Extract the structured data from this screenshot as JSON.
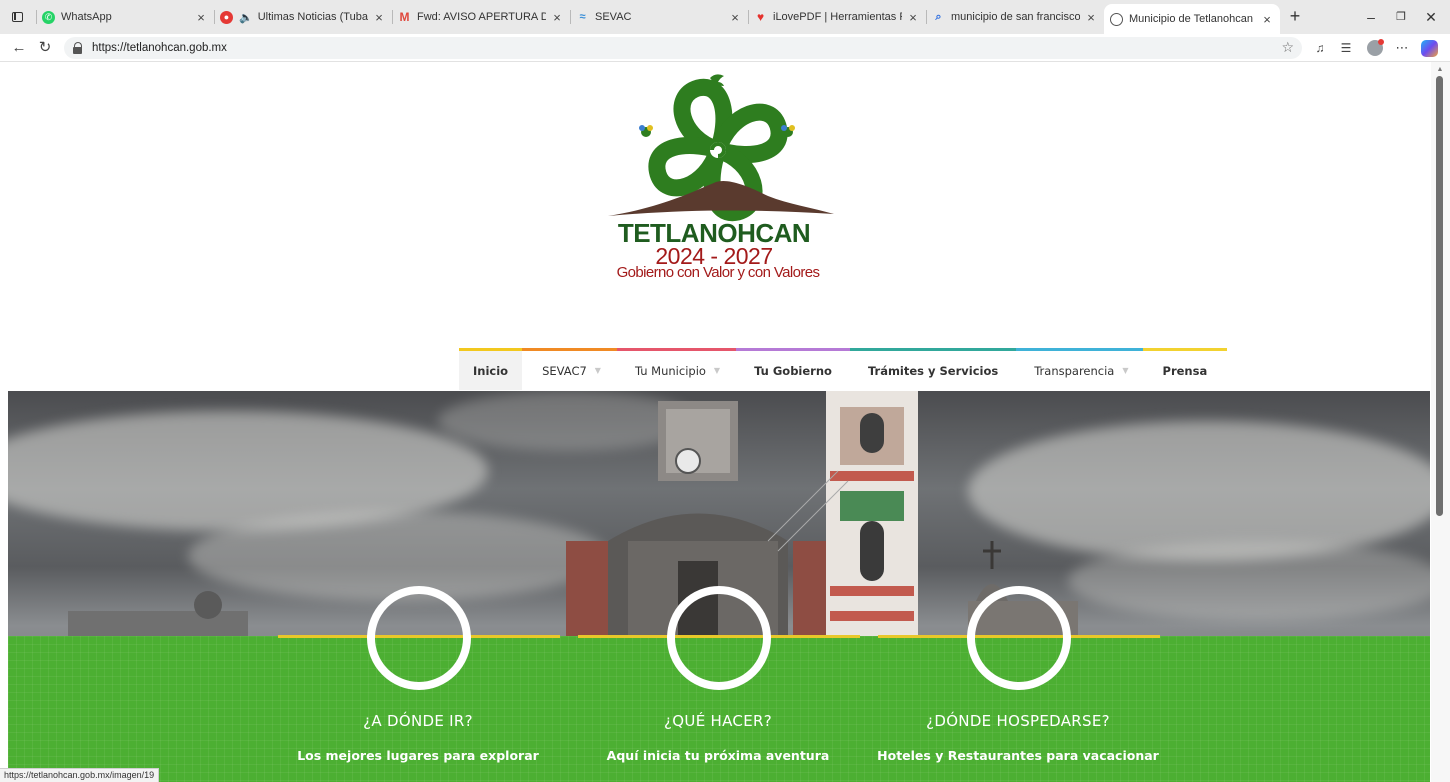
{
  "browser": {
    "tabs": [
      {
        "title": "WhatsApp",
        "icon": "whatsapp-icon",
        "color": "#25d366",
        "active": false
      },
      {
        "title": "Ultimas Noticias (Tuba) - You",
        "icon": "youtube-icon",
        "color": "#e53935",
        "active": false,
        "audio": true
      },
      {
        "title": "Fwd: AVISO APERTURA DE PLATAF",
        "icon": "gmail-icon",
        "color": "#e0473c",
        "active": false
      },
      {
        "title": "SEVAC",
        "icon": "sevac-icon",
        "color": "#3a8fd8",
        "active": false
      },
      {
        "title": "iLovePDF | Herramientas PDF onl",
        "icon": "ilovepdf-icon",
        "color": "#e5322d",
        "active": false
      },
      {
        "title": "municipio de san francisco tetlan",
        "icon": "search-icon",
        "color": "#2f6fe0",
        "active": false
      },
      {
        "title": "Municipio de Tetlanohcan",
        "icon": "globe-icon",
        "color": "#555555",
        "active": true
      }
    ],
    "close_glyph": "×",
    "new_tab_glyph": "+",
    "url": "https://tetlanohcan.gob.mx",
    "status_url": "https://tetlanohcan.gob.mx/imagen/19"
  },
  "logo": {
    "name": "TETLANOHCAN",
    "years": "2024 - 2027",
    "slogan": "Gobierno con Valor y con Valores",
    "colors": {
      "green": "#2e7d1f",
      "red": "#a31a1a",
      "mountain": "#5a3a2e"
    }
  },
  "nav": {
    "items": [
      {
        "label": "Inicio",
        "dropdown": false,
        "accent": "#f2c81e"
      },
      {
        "label": "SEVAC7",
        "dropdown": true,
        "accent": "#f08a24"
      },
      {
        "label": "Tu Municipio",
        "dropdown": true,
        "accent": "#e5566b"
      },
      {
        "label": "Tu Gobierno",
        "dropdown": false,
        "accent": "#b57ad6"
      },
      {
        "label": "Trámites y Servicios",
        "dropdown": false,
        "accent": "#31a89b"
      },
      {
        "label": "Transparencia",
        "dropdown": true,
        "accent": "#3fb2d8"
      },
      {
        "label": "Prensa",
        "dropdown": false,
        "accent": "#f2d230"
      }
    ]
  },
  "features": [
    {
      "title": "¿A DÓNDE IR?",
      "subtitle": "Los mejores lugares para explorar"
    },
    {
      "title": "¿QUÉ HACER?",
      "subtitle": "Aquí inicia tu próxima aventura"
    },
    {
      "title": "¿DÓNDE HOSPEDARSE?",
      "subtitle": "Hoteles y Restaurantes para vacacionar"
    }
  ]
}
